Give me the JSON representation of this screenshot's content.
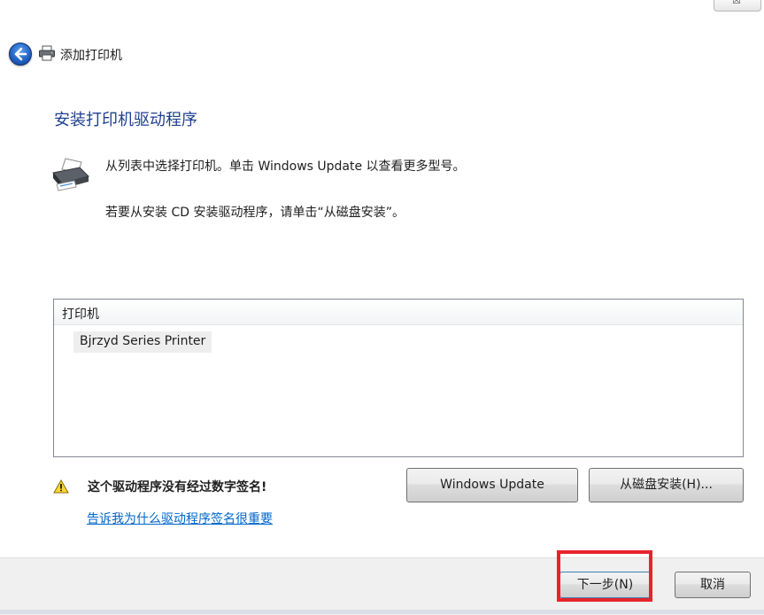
{
  "window": {
    "title": "添加打印机",
    "close_glyph": "☒"
  },
  "page": {
    "heading": "安装打印机驱动程序",
    "instruction_1": "从列表中选择打印机。单击 Windows Update 以查看更多型号。",
    "instruction_2": "若要从安装 CD 安装驱动程序，请单击“从磁盘安装”。"
  },
  "printer_list": {
    "header": "打印机",
    "items": [
      "Bjrzyd Series Printer"
    ]
  },
  "warning": {
    "text": "这个驱动程序没有经过数字签名!",
    "link": "告诉我为什么驱动程序签名很重要"
  },
  "buttons": {
    "windows_update": "Windows Update",
    "have_disk": "从磁盘安装(H)...",
    "next": "下一步(N)",
    "cancel": "取消"
  },
  "colors": {
    "heading": "#1f3f90",
    "link": "#0066cc",
    "highlight": "#e8232a"
  },
  "icons": [
    "back-arrow-icon",
    "printer-icon",
    "warning-icon",
    "close-icon"
  ]
}
